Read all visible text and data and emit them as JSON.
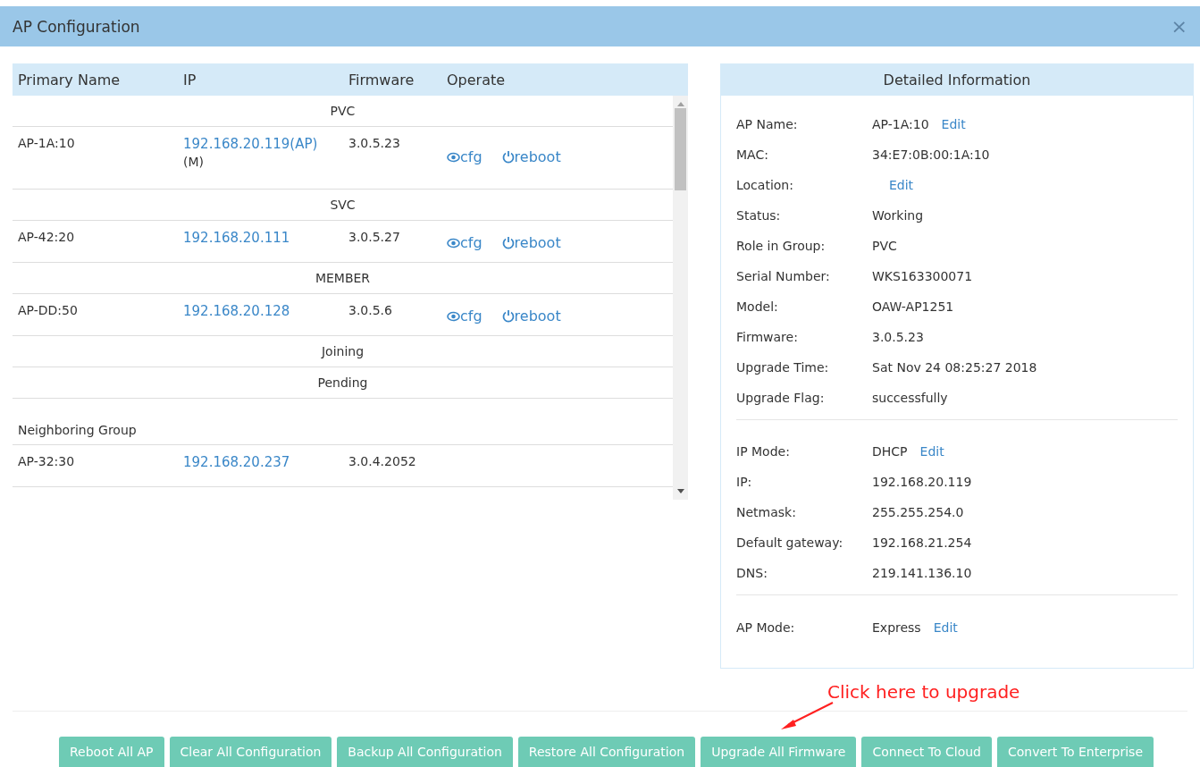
{
  "window": {
    "title": "AP Configuration",
    "close": "×"
  },
  "table": {
    "columns": [
      "Primary Name",
      "IP",
      "Firmware",
      "Operate"
    ],
    "rows": [
      {
        "kind": "group",
        "label": "PVC"
      },
      {
        "kind": "ap",
        "name": "AP-1A:10",
        "ip": "192.168.20.119(AP)",
        "ip_note": "(M)",
        "firmware": "3.0.5.23",
        "actions": [
          "cfg",
          "reboot"
        ]
      },
      {
        "kind": "group",
        "label": "SVC"
      },
      {
        "kind": "ap",
        "name": "AP-42:20",
        "ip": "192.168.20.111",
        "firmware": "3.0.5.27",
        "actions": [
          "cfg",
          "reboot"
        ]
      },
      {
        "kind": "group",
        "label": "MEMBER"
      },
      {
        "kind": "ap",
        "name": "AP-DD:50",
        "ip": "192.168.20.128",
        "firmware": "3.0.5.6",
        "actions": [
          "cfg",
          "reboot"
        ]
      },
      {
        "kind": "group",
        "label": "Joining"
      },
      {
        "kind": "group",
        "label": "Pending"
      },
      {
        "kind": "section",
        "heading": "Neighboring Group"
      },
      {
        "kind": "ap",
        "name": "AP-32:30",
        "ip": "192.168.20.237",
        "firmware": "3.0.4.2052"
      }
    ]
  },
  "details": {
    "title": "Detailed Information",
    "groups": [
      [
        {
          "label": "AP Name:",
          "value": "AP-1A:10",
          "edit": "Edit"
        },
        {
          "label": "MAC:",
          "value": "34:E7:0B:00:1A:10"
        },
        {
          "label": "Location:",
          "edit": "Edit"
        },
        {
          "label": "Status:",
          "value": "Working"
        },
        {
          "label": "Role in Group:",
          "value": "PVC"
        },
        {
          "label": "Serial Number:",
          "value": "WKS163300071"
        },
        {
          "label": "Model:",
          "value": "OAW-AP1251"
        },
        {
          "label": "Firmware:",
          "value": "3.0.5.23"
        },
        {
          "label": "Upgrade Time:",
          "value": "Sat Nov 24 08:25:27 2018"
        },
        {
          "label": "Upgrade Flag:",
          "value": "successfully"
        }
      ],
      [
        {
          "label": "IP Mode:",
          "value": "DHCP",
          "edit": "Edit"
        },
        {
          "label": "IP:",
          "value": "192.168.20.119"
        },
        {
          "label": "Netmask:",
          "value": "255.255.254.0"
        },
        {
          "label": "Default gateway:",
          "value": "192.168.21.254"
        },
        {
          "label": "DNS:",
          "value": "219.141.136.10"
        }
      ],
      [
        {
          "label": "AP Mode:",
          "value": "Express",
          "edit": "Edit"
        }
      ]
    ]
  },
  "annotation": "Click here to upgrade",
  "buttons": [
    "Reboot All AP",
    "Clear All Configuration",
    "Backup All Configuration",
    "Restore All Configuration",
    "Upgrade All Firmware",
    "Connect To Cloud",
    "Convert To Enterprise"
  ]
}
